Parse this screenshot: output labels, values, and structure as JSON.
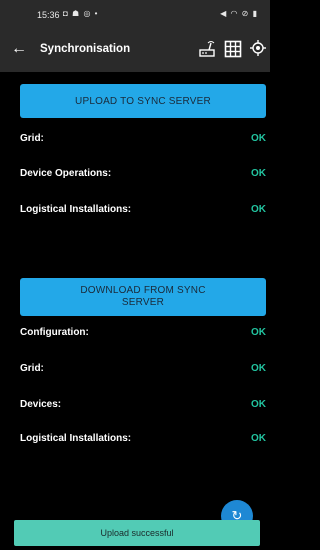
{
  "status_bar": {
    "time": "15:36",
    "left_icons": "◘ ☗ ◎ •",
    "right_icons": "◀ ◠ ⊘ ▮"
  },
  "app_bar": {
    "title": "Synchronisation",
    "icons": [
      "back-arrow-icon",
      "router-icon",
      "grid-icon",
      "gps-locate-icon"
    ]
  },
  "upload": {
    "button_label": "UPLOAD TO SYNC SERVER",
    "items": [
      {
        "label": "Grid:",
        "status": "OK"
      },
      {
        "label": "Device Operations:",
        "status": "OK"
      },
      {
        "label": "Logistical Installations:",
        "status": "OK"
      }
    ]
  },
  "download": {
    "button_label": "DOWNLOAD FROM SYNC SERVER",
    "items": [
      {
        "label": "Configuration:",
        "status": "OK"
      },
      {
        "label": "Grid:",
        "status": "OK"
      },
      {
        "label": "Devices:",
        "status": "OK"
      },
      {
        "label": "Logistical Installations:",
        "status": "OK"
      }
    ]
  },
  "fab": {
    "icon": "refresh-icon",
    "glyph": "↻"
  },
  "toast": {
    "message": "Upload successful"
  },
  "colors": {
    "background": "#000000",
    "bar": "#2a2a2a",
    "button": "#23a8e8",
    "ok_status": "#22c4a0",
    "toast": "#52cbb5",
    "fab": "#1e88d4"
  }
}
